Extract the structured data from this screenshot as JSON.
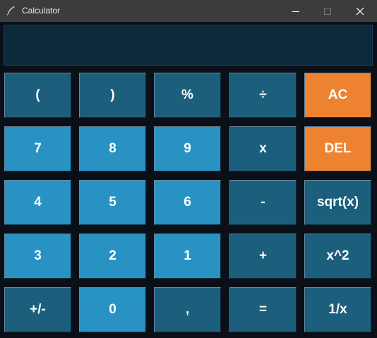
{
  "window": {
    "title": "Calculator",
    "controls": {
      "minimize": "—",
      "maximize": "☐",
      "close": "✕"
    }
  },
  "display": {
    "value": ""
  },
  "colors": {
    "titlebar": "#3c3c3c",
    "background": "#0b0f18",
    "display": "#0d2a3d",
    "key_dark": "#1b5f7d",
    "key_light": "#2892c2",
    "key_orange": "#ed8331"
  },
  "keys": [
    {
      "label": "(",
      "style": "dark",
      "name": "open-paren-button"
    },
    {
      "label": ")",
      "style": "dark",
      "name": "close-paren-button"
    },
    {
      "label": "%",
      "style": "dark",
      "name": "percent-button"
    },
    {
      "label": "÷",
      "style": "dark",
      "name": "divide-button"
    },
    {
      "label": "AC",
      "style": "orange",
      "name": "all-clear-button"
    },
    {
      "label": "7",
      "style": "light",
      "name": "digit-7-button"
    },
    {
      "label": "8",
      "style": "light",
      "name": "digit-8-button"
    },
    {
      "label": "9",
      "style": "light",
      "name": "digit-9-button"
    },
    {
      "label": "x",
      "style": "dark",
      "name": "multiply-button"
    },
    {
      "label": "DEL",
      "style": "orange",
      "name": "delete-button"
    },
    {
      "label": "4",
      "style": "light",
      "name": "digit-4-button"
    },
    {
      "label": "5",
      "style": "light",
      "name": "digit-5-button"
    },
    {
      "label": "6",
      "style": "light",
      "name": "digit-6-button"
    },
    {
      "label": "-",
      "style": "dark",
      "name": "subtract-button"
    },
    {
      "label": "sqrt(x)",
      "style": "dark",
      "name": "sqrt-button"
    },
    {
      "label": "3",
      "style": "light",
      "name": "digit-3-button"
    },
    {
      "label": "2",
      "style": "light",
      "name": "digit-2-button"
    },
    {
      "label": "1",
      "style": "light",
      "name": "digit-1-button"
    },
    {
      "label": "+",
      "style": "dark",
      "name": "add-button"
    },
    {
      "label": "x^2",
      "style": "dark",
      "name": "square-button"
    },
    {
      "label": "+/-",
      "style": "dark",
      "name": "negate-button"
    },
    {
      "label": "0",
      "style": "light",
      "name": "digit-0-button"
    },
    {
      "label": ",",
      "style": "dark",
      "name": "decimal-button"
    },
    {
      "label": "=",
      "style": "dark",
      "name": "equals-button"
    },
    {
      "label": "1/x",
      "style": "dark",
      "name": "reciprocal-button"
    }
  ]
}
